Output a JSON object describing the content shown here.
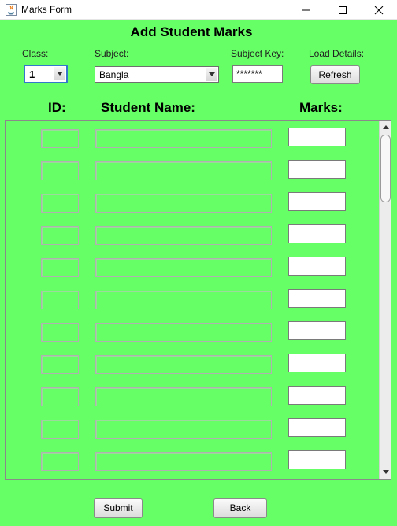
{
  "window": {
    "title": "Marks Form"
  },
  "form": {
    "title": "Add Student Marks"
  },
  "labels": {
    "class": "Class:",
    "subject": "Subject:",
    "subject_key": "Subject Key:",
    "load_details": "Load Details:"
  },
  "class_select": {
    "selected": "1"
  },
  "subject_select": {
    "selected": "Bangla"
  },
  "subject_key": {
    "value": "*******"
  },
  "buttons": {
    "refresh": "Refresh",
    "submit": "Submit",
    "back": "Back"
  },
  "columns": {
    "id": "ID:",
    "name": "Student Name:",
    "marks": "Marks:"
  },
  "rows": [
    {
      "id": "",
      "name": "",
      "marks": ""
    },
    {
      "id": "",
      "name": "",
      "marks": ""
    },
    {
      "id": "",
      "name": "",
      "marks": ""
    },
    {
      "id": "",
      "name": "",
      "marks": ""
    },
    {
      "id": "",
      "name": "",
      "marks": ""
    },
    {
      "id": "",
      "name": "",
      "marks": ""
    },
    {
      "id": "",
      "name": "",
      "marks": ""
    },
    {
      "id": "",
      "name": "",
      "marks": ""
    },
    {
      "id": "",
      "name": "",
      "marks": ""
    },
    {
      "id": "",
      "name": "",
      "marks": ""
    },
    {
      "id": "",
      "name": "",
      "marks": ""
    }
  ],
  "colors": {
    "background": "#66ff66",
    "accent": "#3377cc"
  }
}
